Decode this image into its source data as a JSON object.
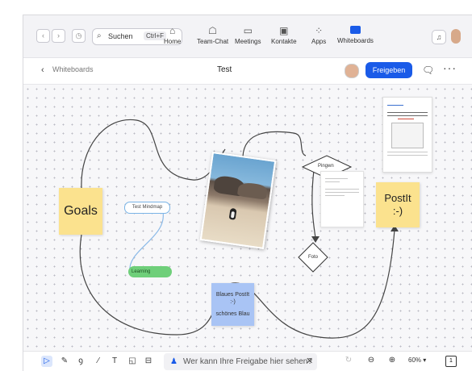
{
  "topbar": {
    "search_label": "Suchen",
    "search_shortcut": "Ctrl+F",
    "tabs": [
      {
        "label": "Home",
        "icon": "home-icon"
      },
      {
        "label": "Team-Chat",
        "icon": "chat-icon"
      },
      {
        "label": "Meetings",
        "icon": "video-icon"
      },
      {
        "label": "Kontakte",
        "icon": "contacts-icon"
      },
      {
        "label": "Apps",
        "icon": "apps-icon"
      },
      {
        "label": "Whiteboards",
        "icon": "whiteboard-icon"
      }
    ]
  },
  "whiteboard": {
    "back_label": "Whiteboards",
    "title": "Test",
    "share_label": "Freigeben"
  },
  "canvas": {
    "sticky_goals": "Goals",
    "sticky_postit_line1": "PostIt",
    "sticky_postit_line2": ":-)",
    "blue_note_line1": "Blaues PostIt",
    "blue_note_line2": ":-)",
    "blue_note_line3": "schönes Blau",
    "mindmap_node": "Test Mindmap",
    "mindmap_child": "Learning",
    "diamond_pinguin": "Pingwn",
    "diamond_foto": "Foto"
  },
  "toolbar": {
    "share_notice": "Wer kann Ihre Freigabe hier sehen?",
    "zoom": "60%",
    "accent": "#1a5be8"
  }
}
